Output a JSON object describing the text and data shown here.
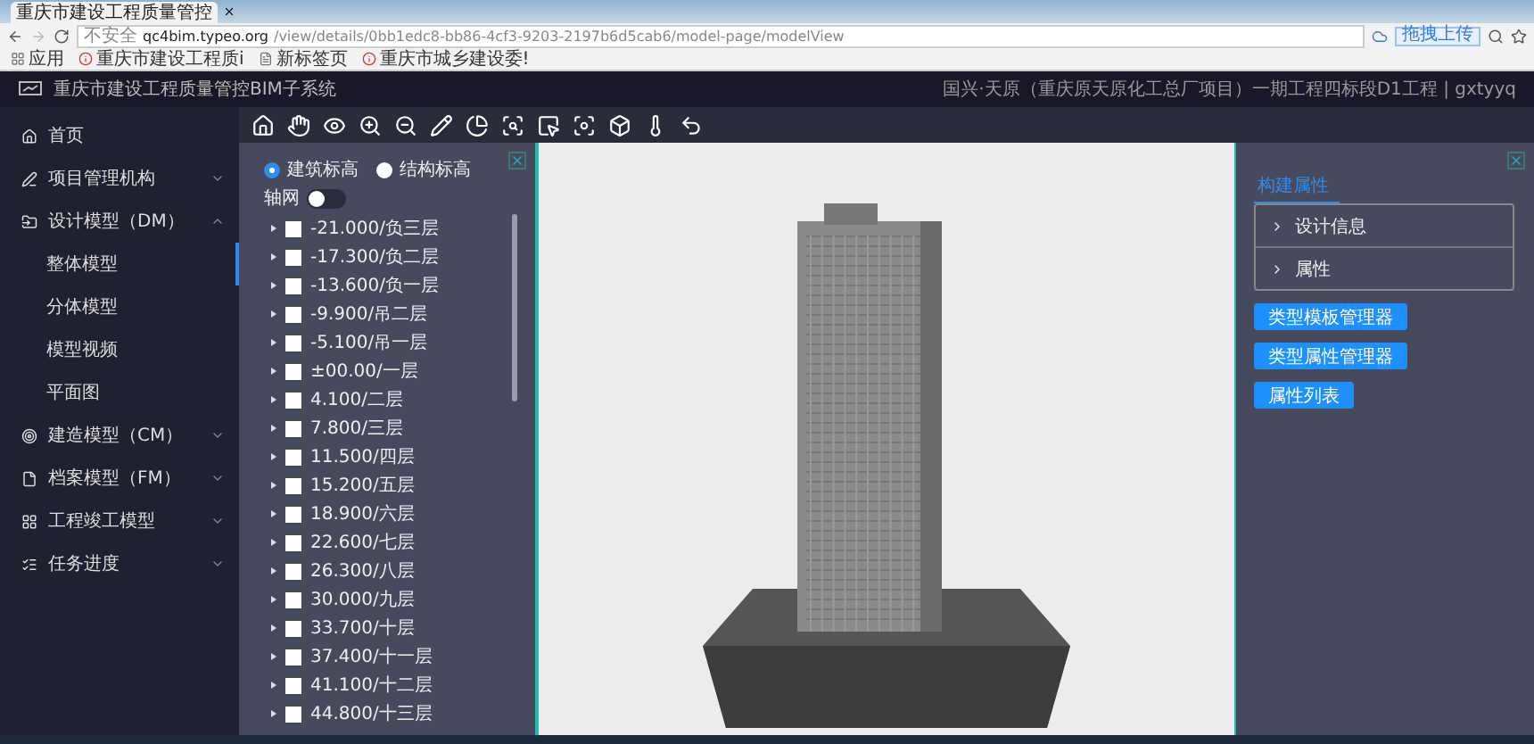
{
  "browser": {
    "tab_title": "重庆市建设工程质量管控",
    "address": {
      "insecure_label": "不安全",
      "host": "qc4bim.typeo.org",
      "path": "/view/details/0bb1edc8-bb86-4cf3-9203-2197b6d5cab6/model-page/modelView"
    },
    "upload_button": "拖拽上传",
    "bookmarks": [
      {
        "label": "应用",
        "kind": "apps"
      },
      {
        "label": "重庆市建设工程质i",
        "kind": "site"
      },
      {
        "label": "新标签页",
        "kind": "page"
      },
      {
        "label": "重庆市城乡建设委!",
        "kind": "site"
      }
    ]
  },
  "app": {
    "title": "重庆市建设工程质量管控BIM子系统",
    "project": "国兴·天原（重庆原天原化工总厂项目）一期工程四标段D1工程 | gxtyyq"
  },
  "sidebar": {
    "items": [
      {
        "label": "首页"
      },
      {
        "label": "项目管理机构",
        "expanded": false
      },
      {
        "label": "设计模型（DM）",
        "expanded": true,
        "children": [
          {
            "label": "整体模型",
            "selected": true
          },
          {
            "label": "分体模型",
            "selected": false
          },
          {
            "label": "模型视频",
            "selected": false
          },
          {
            "label": "平面图",
            "selected": false
          }
        ]
      },
      {
        "label": "建造模型（CM）",
        "expanded": false
      },
      {
        "label": "档案模型（FM）",
        "expanded": false
      },
      {
        "label": "工程竣工模型",
        "expanded": false
      },
      {
        "label": "任务进度",
        "expanded": false
      }
    ]
  },
  "floor_panel": {
    "radios": [
      {
        "label": "建筑标高",
        "selected": true
      },
      {
        "label": "结构标高",
        "selected": false
      }
    ],
    "grid_toggle": {
      "label": "轴网",
      "on": false
    },
    "floors": [
      {
        "label": "-21.000/负三层",
        "checked": false
      },
      {
        "label": "-17.300/负二层",
        "checked": false
      },
      {
        "label": "-13.600/负一层",
        "checked": false
      },
      {
        "label": "-9.900/吊二层",
        "checked": false
      },
      {
        "label": "-5.100/吊一层",
        "checked": false
      },
      {
        "label": "±00.00/一层",
        "checked": false
      },
      {
        "label": "4.100/二层",
        "checked": false
      },
      {
        "label": "7.800/三层",
        "checked": false
      },
      {
        "label": "11.500/四层",
        "checked": false
      },
      {
        "label": "15.200/五层",
        "checked": false
      },
      {
        "label": "18.900/六层",
        "checked": false
      },
      {
        "label": "22.600/七层",
        "checked": false
      },
      {
        "label": "26.300/八层",
        "checked": false
      },
      {
        "label": "30.000/九层",
        "checked": false
      },
      {
        "label": "33.700/十层",
        "checked": false
      },
      {
        "label": "37.400/十一层",
        "checked": false
      },
      {
        "label": "41.100/十二层",
        "checked": false
      },
      {
        "label": "44.800/十三层",
        "checked": false
      }
    ]
  },
  "property_panel": {
    "tabs": [
      {
        "label": "构建属性",
        "selected": true
      }
    ],
    "sections": [
      {
        "label": "设计信息",
        "expanded": false
      },
      {
        "label": "属性",
        "expanded": false
      }
    ],
    "buttons": [
      "类型模板管理器",
      "类型属性管理器",
      "属性列表"
    ]
  }
}
